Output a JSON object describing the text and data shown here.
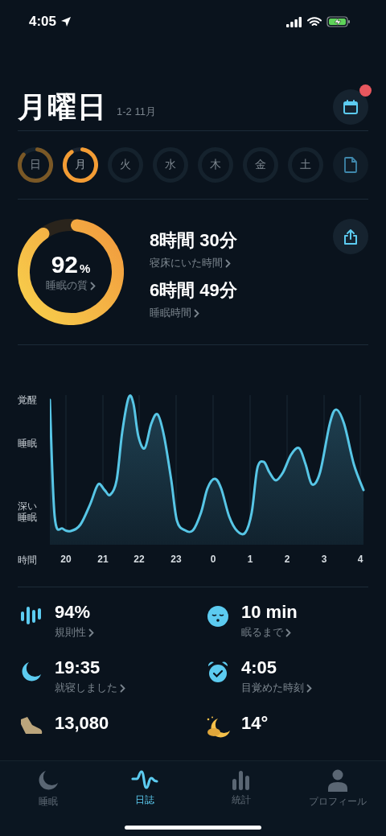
{
  "status_bar": {
    "time": "4:05"
  },
  "header": {
    "title": "月曜日",
    "date_range": "1-2 11月",
    "calendar_badge": true
  },
  "days": [
    {
      "label": "日",
      "level": 0.88,
      "selected": false
    },
    {
      "label": "月",
      "level": 0.92,
      "selected": true
    },
    {
      "label": "火",
      "selected": false
    },
    {
      "label": "水",
      "selected": false
    },
    {
      "label": "木",
      "selected": false
    },
    {
      "label": "金",
      "selected": false
    },
    {
      "label": "土",
      "selected": false
    }
  ],
  "summary": {
    "quality": {
      "value": "92",
      "unit": "%",
      "label": "睡眠の質",
      "level": 0.92
    },
    "metrics": [
      {
        "value": "8時間 30分",
        "label": "寝床にいた時間"
      },
      {
        "value": "6時間 49分",
        "label": "睡眠時間"
      }
    ]
  },
  "chart": {
    "y_labels": [
      "覚醒",
      "睡眠",
      "深い睡眠"
    ],
    "x_label": "時間",
    "x_ticks": [
      "20",
      "21",
      "22",
      "23",
      "0",
      "1",
      "2",
      "3",
      "4"
    ]
  },
  "stats": [
    {
      "value": "94%",
      "label": "規則性"
    },
    {
      "value": "10 min",
      "label": "眠るまで"
    },
    {
      "value": "19:35",
      "label": "就寝しました"
    },
    {
      "value": "4:05",
      "label": "目覚めた時刻"
    },
    {
      "value": "13,080"
    },
    {
      "value": "14°"
    }
  ],
  "tabs": [
    {
      "label": "睡眠",
      "selected": false
    },
    {
      "label": "日誌",
      "selected": true
    },
    {
      "label": "統計",
      "selected": false
    },
    {
      "label": "プロフィール",
      "selected": false
    }
  ]
}
